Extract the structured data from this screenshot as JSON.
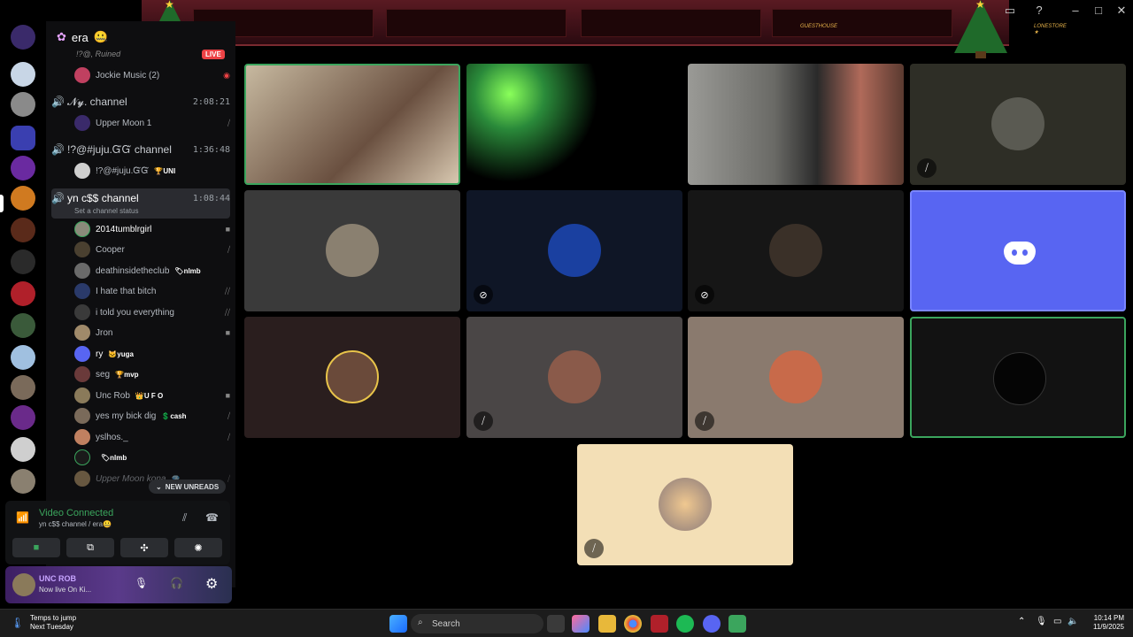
{
  "banner": {
    "left_text": "GUESTHOUSE",
    "right_text": "LONESTORE ★"
  },
  "server": {
    "name": "era",
    "emoji": "🤐",
    "live_label": "LIVE"
  },
  "channels": [
    {
      "name": "Jockie Music (2)",
      "kind": "user"
    },
    {
      "name": "𝓝𝔂. channel",
      "time": "2:08:21",
      "users": [
        {
          "name": "Upper Moon 1"
        }
      ]
    },
    {
      "name": "!?@#juju.ᏳᏳ channel",
      "time": "1:36:48",
      "users": [
        {
          "name": "!?@#juju.ᏳᏳ",
          "tag": "🏆UNI"
        }
      ]
    },
    {
      "name": "yn c$$ channel",
      "time": "1:08:44",
      "status": "Set a channel status"
    }
  ],
  "top_cut_text": "!?@, Ruined",
  "members": [
    {
      "name": "2014tumblrgirl",
      "tag": "",
      "icon": "video-icon",
      "color": "#8a8a7a"
    },
    {
      "name": "Cooper",
      "tag": "",
      "icon": "deafened-icon",
      "color": "#4a4030"
    },
    {
      "name": "deathinsidetheclub",
      "tag": "🏷nlmb",
      "icon": "",
      "color": "#6a6a6a"
    },
    {
      "name": "I hate that bitch",
      "tag": "",
      "icon": "deafened-icon",
      "color": "#2a3a6a"
    },
    {
      "name": "i told you everything",
      "tag": "",
      "icon": "deafened-icon",
      "color": "#3a3a3a"
    },
    {
      "name": "Jron",
      "tag": "",
      "icon": "video-icon",
      "color": "#a08a6a"
    },
    {
      "name": "ry",
      "tag": "🐱yuga",
      "icon": "",
      "color": "#5865f2"
    },
    {
      "name": "seg",
      "tag": "🏆mvp",
      "icon": "",
      "color": "#6a3a3a"
    },
    {
      "name": "Unc Rob",
      "tag": "👑U F O",
      "icon": "video-icon",
      "color": "#8a7a5a"
    },
    {
      "name": "yes my bick dig",
      "tag": "💲cash",
      "icon": "deafened-icon",
      "color": "#7a6a5a"
    },
    {
      "name": "yslhos._",
      "tag": "",
      "icon": "deafened-icon",
      "color": "#c08060"
    },
    {
      "name": "",
      "tag": "🏷nlmb",
      "icon": "",
      "color": "#1a1a1a"
    },
    {
      "name": "Upper Moon kona",
      "tag": "💎",
      "icon": "deafened-icon",
      "color": "#c0a070"
    }
  ],
  "new_unreads": "NEW UNREADS",
  "voice": {
    "title": "Video Connected",
    "subtitle": "yn c$$ channel / era🤐"
  },
  "user": {
    "name": "UNC ROB",
    "status": "Now live On Ki..."
  },
  "taskbar": {
    "weather_title": "Temps to jump",
    "weather_sub": "Next Tuesday",
    "search": "Search",
    "time": "10:14 PM",
    "date": "11/9/2025"
  },
  "colors": {
    "accent_green": "#3ba55d",
    "blurple": "#5865f2",
    "live_red": "#ed4245"
  }
}
